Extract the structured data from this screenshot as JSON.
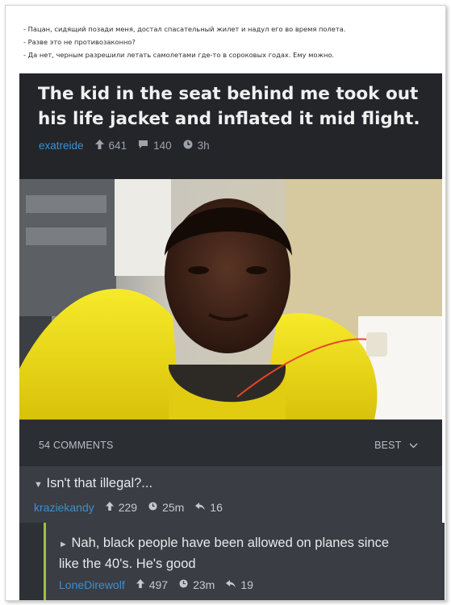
{
  "caption": {
    "lines": [
      "- Пацан, сидящий позади меня, достал спасательный жилет и надул его во время полета.",
      "- Разве это не противозаконно?",
      "- Да нет, черным разрешили летать самолетами где-то в сороковых годах. Ему можно."
    ]
  },
  "post": {
    "title_line1": "The kid in the seat behind me took out",
    "title_line2": "his life jacket and inflated it mid flight.",
    "author": "exatreide",
    "upvotes": "641",
    "comments": "140",
    "age": "3h"
  },
  "comments_bar": {
    "count_label": "54 COMMENTS",
    "sort_label": "BEST"
  },
  "comments": [
    {
      "collapse": "▼",
      "text": "Isn't that illegal?...",
      "author": "kraziekandy",
      "upvotes": "229",
      "age": "25m",
      "replies": "16"
    },
    {
      "collapse": "►",
      "text_line1": "Nah, black people have been allowed on planes since",
      "text_line2": "like the 40's. He's good",
      "author": "LoneDirewolf",
      "upvotes": "497",
      "age": "23m",
      "replies": "19"
    }
  ],
  "colors": {
    "accent_link": "#3f8fd0",
    "reply_border": "#9ec13a",
    "life_jacket": "#f2e21a"
  },
  "icons": {
    "upvote": "arrow-up-icon",
    "comment": "speech-bubble-icon",
    "time": "clock-icon",
    "reply": "reply-arrow-icon",
    "sort": "chevron-down-icon"
  }
}
